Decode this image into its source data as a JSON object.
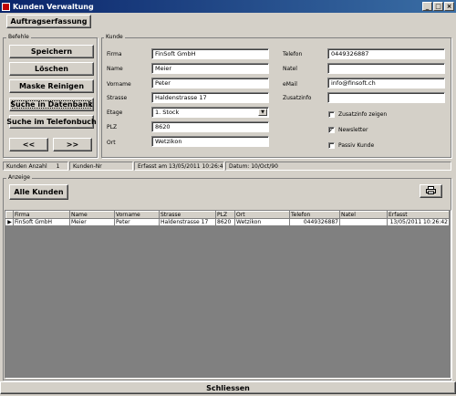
{
  "window": {
    "title": "Kunden Verwaltung",
    "controls": [
      "_",
      "□",
      "×"
    ]
  },
  "toolbar": {
    "auftragserfassung": "Auftragserfassung"
  },
  "befehle": {
    "label": "Befehle",
    "speichern": "Speichern",
    "loeschen": "Löschen",
    "maske_reinigen": "Maske Reinigen",
    "suche_datenbank": "Suche in Datenbank",
    "suche_telefonbuch": "Suche im Telefonbuch",
    "prev": "<<",
    "next": ">>"
  },
  "kunde": {
    "label": "Kunde",
    "firma_label": "Firma",
    "firma": "FinSoft GmbH",
    "name_label": "Name",
    "name": "Meier",
    "vorname_label": "Vorname",
    "vorname": "Peter",
    "strasse_label": "Strasse",
    "strasse": "Haldenstrasse 17",
    "etage_label": "Etage",
    "etage": "1. Stock",
    "plz_label": "PLZ",
    "plz": "8620",
    "ort_label": "Ort",
    "ort": "Wetzikon",
    "telefon_label": "Telefon",
    "telefon": "0449326887",
    "natel_label": "Natel",
    "natel": "",
    "email_label": "eMail",
    "email": "info@finsoft.ch",
    "zusatzinfo_label": "Zusatzinfo",
    "zusatzinfo": "",
    "zusatzinfo_zeigen": "Zusatzinfo zeigen",
    "zusatzinfo_checked": false,
    "newsletter": "Newsletter",
    "newsletter_checked": true,
    "passiv_kunde": "Passiv Kunde",
    "passiv_checked": false
  },
  "statusbar": {
    "kunden_anzahl_label": "Kunden Anzahl",
    "kunden_anzahl": "1",
    "kunden_nr_label": "Kunden-Nr",
    "erfasst": "Erfasst am 13/05/2011 10:26:42",
    "datum": "Datum: 10/Oct/90"
  },
  "anzeige": {
    "label": "Anzeige",
    "alle_kunden": "Alle Kunden",
    "print_icon": "printer-icon"
  },
  "grid": {
    "columns": [
      "Firma",
      "Name",
      "Vorname",
      "Strasse",
      "PLZ",
      "Ort",
      "Telefon",
      "Natel",
      "Erfasst"
    ],
    "rows": [
      [
        "FinSoft GmbH",
        "Meier",
        "Peter",
        "Haldenstrasse 17",
        "8620",
        "Wetzikon",
        "0449326887",
        "",
        "13/05/2011 10:26:42"
      ]
    ]
  },
  "footer": {
    "schliessen": "Schliessen"
  }
}
